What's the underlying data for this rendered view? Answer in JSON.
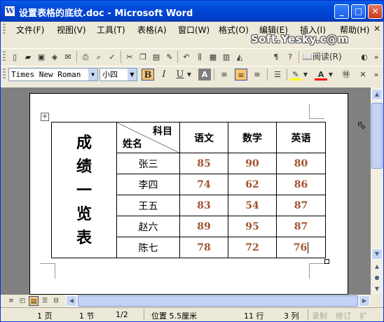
{
  "window": {
    "title": "设置表格的底纹.doc - Microsoft Word",
    "app_icon": "W",
    "buttons": {
      "minimize": "_",
      "maximize": "□",
      "close": "✕"
    }
  },
  "menu": {
    "items": [
      "文件(F)",
      "视图(V)",
      "工具(T)",
      "表格(A)",
      "窗口(W)",
      "格式(O)",
      "编辑(E)",
      "插入(I)",
      "帮助(H)"
    ],
    "doc_close": "✕"
  },
  "standard_toolbar": {
    "read_label": "阅读(R)"
  },
  "formatting_toolbar": {
    "font": "Times New Roman",
    "size": "小四",
    "bold": "B",
    "italic": "I",
    "underline": "U"
  },
  "watermark": "Soft.Yesky.c@m",
  "table": {
    "vertical_title": [
      "成",
      "绩",
      "一",
      "览",
      "表"
    ],
    "diagonal_header": {
      "subject": "科目",
      "name": "姓名"
    },
    "subjects": [
      "语文",
      "数学",
      "英语"
    ],
    "rows": [
      {
        "name": "张三",
        "scores": [
          "85",
          "90",
          "80"
        ]
      },
      {
        "name": "李四",
        "scores": [
          "74",
          "62",
          "86"
        ]
      },
      {
        "name": "王五",
        "scores": [
          "83",
          "54",
          "87"
        ]
      },
      {
        "name": "赵六",
        "scores": [
          "89",
          "95",
          "87"
        ]
      },
      {
        "name": "陈七",
        "scores": [
          "78",
          "72",
          "76"
        ]
      }
    ],
    "score_color": "#a0522d"
  },
  "status_bar": {
    "page": "1 页",
    "section": "1 节",
    "page_of": "1/2",
    "position": "位置 5.5厘米",
    "line": "11 行",
    "column": "3 列",
    "rec": "录制",
    "trk": "修订",
    "ext": "扩"
  }
}
